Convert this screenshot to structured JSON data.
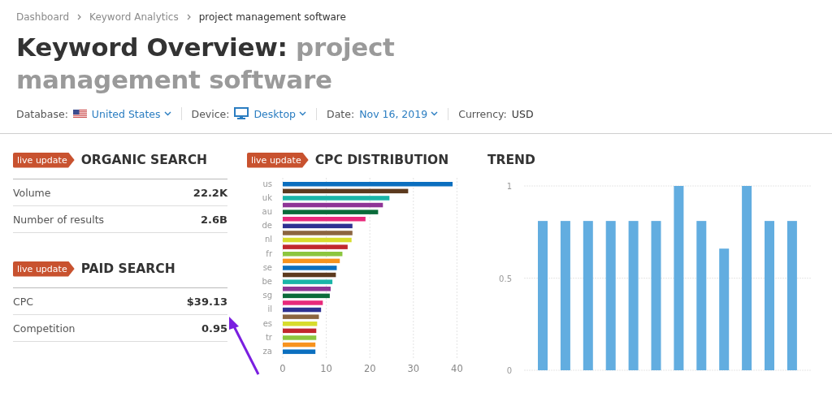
{
  "breadcrumb": [
    {
      "label": "Dashboard",
      "current": false
    },
    {
      "label": "Keyword Analytics",
      "current": false
    },
    {
      "label": "project management software",
      "current": true
    }
  ],
  "title": {
    "prefix": "Keyword Overview:",
    "keyword": "project management software"
  },
  "filters": [
    {
      "kind": "flag",
      "label": "Database:",
      "value": "United States",
      "dropdown": true
    },
    {
      "kind": "monitor",
      "label": "Device:",
      "value": "Desktop",
      "dropdown": true
    },
    {
      "kind": "plain",
      "label": "Date:",
      "value": "Nov 16, 2019",
      "dropdown": true
    },
    {
      "kind": "static",
      "label": "Currency:",
      "value": "USD",
      "dropdown": false
    }
  ],
  "sections": [
    {
      "badge": "live update",
      "title": "ORGANIC SEARCH",
      "rows": [
        {
          "label": "Volume",
          "value": "22.2K"
        },
        {
          "label": "Number of results",
          "value": "2.6B"
        }
      ]
    },
    {
      "badge": "live update",
      "title": "PAID SEARCH",
      "rows": [
        {
          "label": "CPC",
          "value": "$39.13"
        },
        {
          "label": "Competition",
          "value": "0.95"
        }
      ]
    }
  ],
  "cpc_distribution": {
    "badge": "live update",
    "title": "CPC DISTRIBUTION",
    "chart_data": {
      "type": "bar",
      "orientation": "horizontal",
      "categories": [
        "us",
        null,
        "uk",
        null,
        "au",
        null,
        "de",
        null,
        "nl",
        null,
        "fr",
        null,
        "se",
        null,
        "be",
        null,
        "sg",
        null,
        "il",
        null,
        "es",
        null,
        "tr",
        null,
        "za"
      ],
      "values": [
        39.0,
        28.8,
        24.5,
        23.0,
        21.9,
        19.0,
        16.0,
        16.0,
        15.8,
        14.9,
        13.7,
        13.1,
        12.4,
        12.2,
        11.4,
        11.0,
        10.8,
        9.2,
        8.8,
        8.3,
        7.9,
        7.7,
        7.7,
        7.5,
        7.5
      ],
      "grid": true,
      "xlim": [
        0,
        40
      ],
      "xticks": [
        0,
        10,
        20,
        30,
        40
      ]
    }
  },
  "trend": {
    "title": "TREND",
    "chart_data": {
      "type": "bar",
      "grid": true,
      "values": [
        0.81,
        0.81,
        0.81,
        0.81,
        0.81,
        0.81,
        1,
        0.81,
        0.66,
        1,
        0.81,
        0.81
      ],
      "ylim": [
        0,
        1
      ],
      "yticks": [
        {
          "value": 0,
          "label": "0"
        },
        {
          "value": 0.5,
          "label": "0.5"
        },
        {
          "value": 1,
          "label": "1"
        }
      ]
    }
  }
}
